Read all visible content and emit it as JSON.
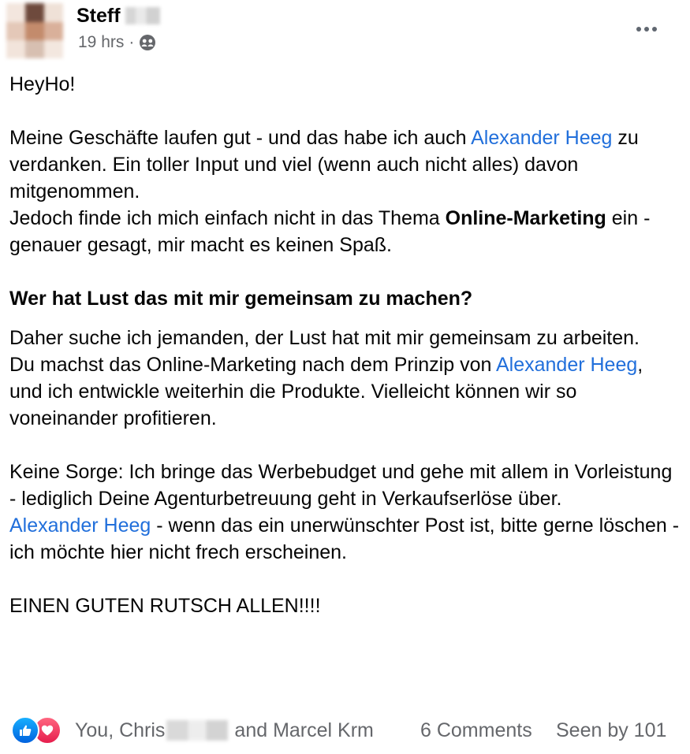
{
  "post": {
    "author_name": "Steff",
    "timestamp": "19 hrs",
    "separator": "·",
    "audience_icon": "group-icon",
    "more_icon": "more-options-icon"
  },
  "body": {
    "greeting": "HeyHo!",
    "p1_pre": "Meine Geschäfte laufen gut - und das habe ich auch ",
    "p1_mention": "Alexander Heeg",
    "p1_post": " zu verdanken. Ein toller Input und viel (wenn auch nicht alles) davon mitgenommen.",
    "p2_pre": "Jedoch finde ich mich einfach nicht in das Thema ",
    "p2_bold": "Online-Marketing",
    "p2_post": " ein - genauer gesagt, mir macht es keinen Spaß.",
    "heading": "Wer hat Lust das mit mir gemeinsam zu machen?",
    "p3": "Daher suche ich jemanden, der Lust hat mit mir gemeinsam zu arbeiten.",
    "p4_pre": "Du machst das Online-Marketing nach dem Prinzip von ",
    "p4_mention": "Alexander Heeg",
    "p4_post": ", und ich entwickle weiterhin die Produkte. Vielleicht können wir so voneinander profitieren.",
    "p5": "Keine Sorge: Ich bringe das Werbebudget und gehe mit allem in Vorleistung - lediglich Deine Agenturbetreuung geht in Verkaufserlöse über.",
    "p6_mention": "Alexander Heeg",
    "p6_post": " - wenn das ein unerwünschter Post ist, bitte gerne löschen - ich möchte hier nicht frech erscheinen.",
    "closing": "EINEN GUTEN RUTSCH ALLEN!!!!"
  },
  "footer": {
    "reactions": [
      "like-icon",
      "love-icon"
    ],
    "reactors_pre": "You, Chris",
    "reactors_post": "and Marcel Krm",
    "comments": "6 Comments",
    "seen_by": "Seen by 101"
  },
  "colors": {
    "link": "#216fdb",
    "meta": "#65676b",
    "text": "#050505",
    "like": "#0866ff",
    "love": "#f33e58"
  }
}
